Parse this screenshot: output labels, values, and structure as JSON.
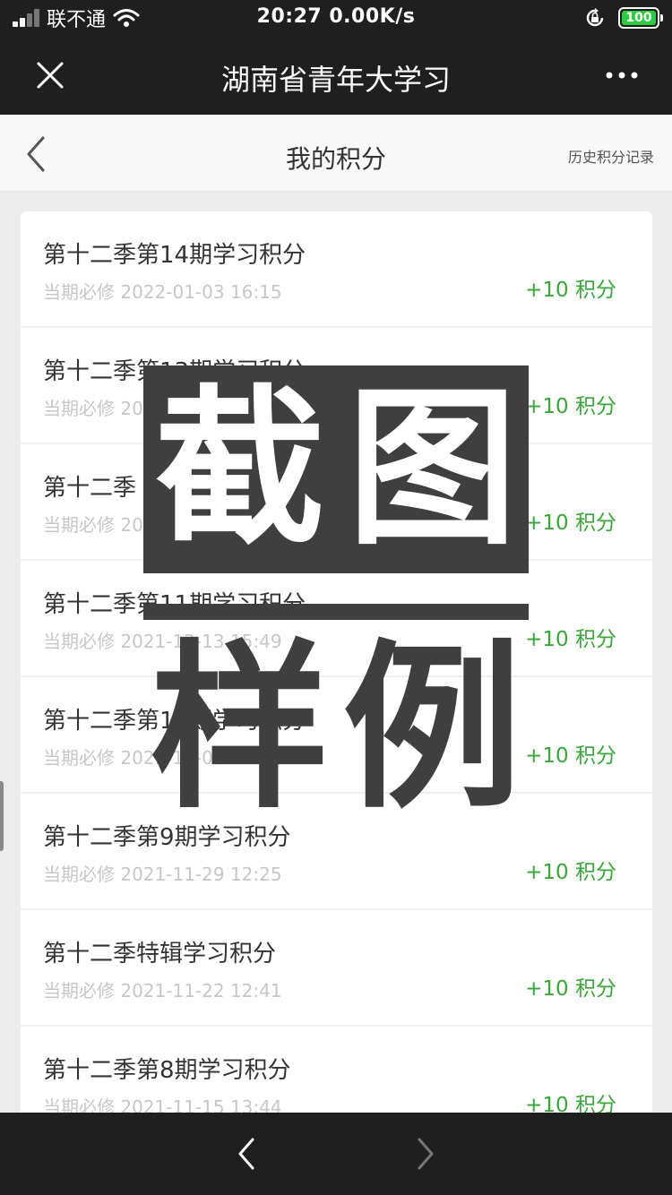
{
  "status_bar": {
    "carrier": "联不通",
    "time_speed": "20:27 0.00K/s",
    "battery": "100",
    "icons": [
      "signal-icon",
      "wifi-icon",
      "rotation-lock-icon",
      "battery-icon"
    ]
  },
  "nav_bar": {
    "title": "湖南省青年大学习",
    "close_icon": "close-icon",
    "more_icon": "more-icon"
  },
  "header": {
    "title": "我的积分",
    "history_link": "历史积分记录",
    "back_icon": "chevron-left-icon"
  },
  "items": [
    {
      "title": "第十二季第14期学习积分",
      "meta": "当期必修 2022-01-03 16:15",
      "points": "+10 积分"
    },
    {
      "title": "第十二季第13期学习积分",
      "meta": "当期必修 20",
      "points": "+10 积分"
    },
    {
      "title": "第十二季",
      "meta": "当期必修 20",
      "points": "+10 积分"
    },
    {
      "title": "第十二季第11期学习积分",
      "meta": "当期必修 2021-12-13 15:49",
      "points": "+10 积分"
    },
    {
      "title": "第十二季第10期学习积分",
      "meta": "当期必修 2021-12-06 12:",
      "points": "+10 积分"
    },
    {
      "title": "第十二季第9期学习积分",
      "meta": "当期必修 2021-11-29 12:25",
      "points": "+10 积分"
    },
    {
      "title": "第十二季特辑学习积分",
      "meta": "当期必修 2021-11-22 12:41",
      "points": "+10 积分"
    },
    {
      "title": "第十二季第8期学习积分",
      "meta": "当期必修 2021-11-15 13:44",
      "points": "+10 积分"
    }
  ],
  "watermark": {
    "top": [
      "截",
      "图"
    ],
    "bottom": [
      "样",
      "例"
    ]
  },
  "toolbar": {
    "back_icon": "chevron-left-icon",
    "forward_icon": "chevron-right-icon"
  },
  "colors": {
    "bar_bg": "#1f1f1f",
    "points_green": "#3aa63a",
    "watermark": "#3f3f3f",
    "battery_green": "#2ecc40"
  }
}
